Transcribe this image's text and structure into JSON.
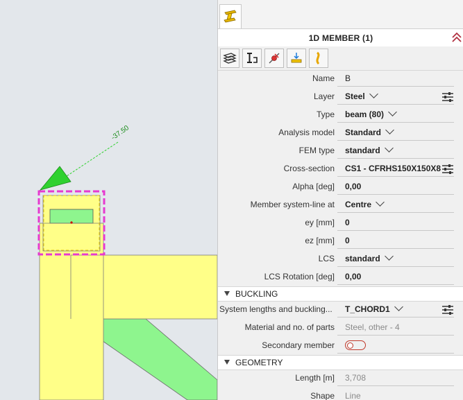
{
  "viewport": {
    "dimension_label": "-37.50",
    "colors": {
      "member_yellow": "#ffff88",
      "member_green": "#8ef58e",
      "selection": "#e63ad0",
      "arrow_green": "#2fd12f"
    }
  },
  "panel": {
    "tab_icon": "steel-member-icon",
    "header": {
      "title": "1D MEMBER (1)",
      "collapse_icon": "double-chevron-up-icon"
    },
    "toolbar": {
      "buttons": [
        {
          "icon": "layers-icon"
        },
        {
          "icon": "cross-section-icon"
        },
        {
          "icon": "pin-icon"
        },
        {
          "icon": "load-icon"
        },
        {
          "icon": "curve-icon"
        }
      ]
    },
    "properties": [
      {
        "label": "Name",
        "value": "B"
      },
      {
        "label": "Layer",
        "value": "Steel"
      },
      {
        "label": "Type",
        "value": "beam (80)"
      },
      {
        "label": "Analysis model",
        "value": "Standard"
      },
      {
        "label": "FEM type",
        "value": "standard"
      },
      {
        "label": "Cross-section",
        "value": "CS1 - CFRHS150X150X8"
      },
      {
        "label": "Alpha [deg]",
        "value": "0,00"
      },
      {
        "label": "Member system-line at",
        "value": "Centre"
      },
      {
        "label": "ey [mm]",
        "value": "0"
      },
      {
        "label": "ez [mm]",
        "value": "0"
      },
      {
        "label": "LCS",
        "value": "standard"
      },
      {
        "label": "LCS Rotation [deg]",
        "value": "0,00"
      }
    ],
    "buckling": {
      "title": "BUCKLING",
      "system_lengths": {
        "label": "System lengths and buckling...",
        "value": "T_CHORD1"
      },
      "material": {
        "label": "Material and no. of parts",
        "value": "Steel, other - 4"
      },
      "secondary": {
        "label": "Secondary member"
      }
    },
    "geometry": {
      "title": "GEOMETRY",
      "length": {
        "label": "Length [m]",
        "value": "3,708"
      },
      "shape": {
        "label": "Shape",
        "value": "Line"
      }
    },
    "accent_color": "#c0392b"
  }
}
